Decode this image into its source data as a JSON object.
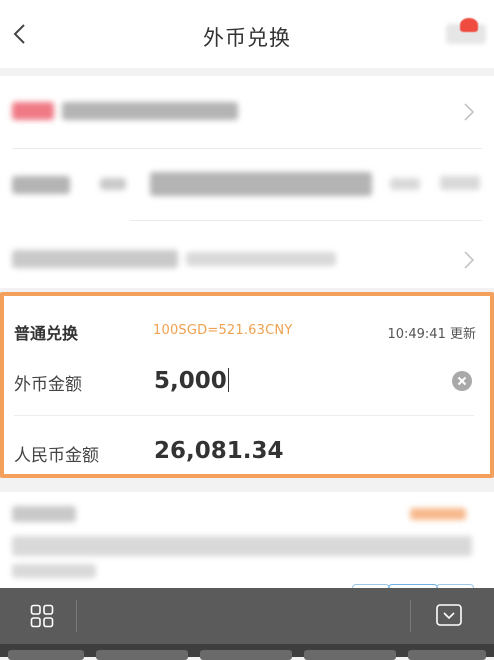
{
  "header": {
    "title": "外币兑换",
    "back_icon": "chevron-left-icon",
    "right_icon": "notification-icon"
  },
  "exchange": {
    "type_label": "普通兑换",
    "rate": "100SGD=521.63CNY",
    "update_time": "10:49:41",
    "update_label": "更新",
    "foreign_label": "外币金额",
    "foreign_amount": "5,000",
    "cny_label": "人民币金额",
    "cny_amount": "26,081.34",
    "clear_icon": "clear-circle-icon"
  },
  "toolbar": {
    "left_icon": "grid-icon",
    "right_icon": "hide-keyboard-icon"
  },
  "colors": {
    "accent_border": "#f2a05b",
    "rate_text": "#f0a14f",
    "toolbar_bg": "#5b5b5b"
  }
}
